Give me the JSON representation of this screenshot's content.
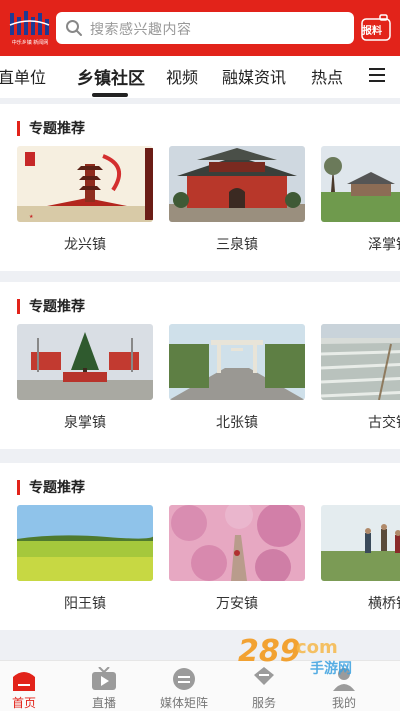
{
  "header": {
    "logo_text": "中乐乡镇 新闻网",
    "search_placeholder": "搜索感兴趣内容",
    "report_label": "报料",
    "brand_color": "#e2231a"
  },
  "tabs": [
    {
      "label": "县直单位"
    },
    {
      "label": "乡镇社区",
      "active": true
    },
    {
      "label": "视频"
    },
    {
      "label": "融媒资讯"
    },
    {
      "label": "热点"
    }
  ],
  "sections": [
    {
      "title": "专题推荐",
      "items": [
        {
          "label": "龙兴镇",
          "icon": "monument-image"
        },
        {
          "label": "三泉镇",
          "icon": "temple-image"
        },
        {
          "label": "泽掌镇",
          "icon": "village-image"
        }
      ]
    },
    {
      "title": "专题推荐",
      "items": [
        {
          "label": "泉掌镇",
          "icon": "square-image"
        },
        {
          "label": "北张镇",
          "icon": "gate-image"
        },
        {
          "label": "古交镇",
          "icon": "greenhouse-image"
        }
      ]
    },
    {
      "title": "专题推荐",
      "items": [
        {
          "label": "阳王镇",
          "icon": "field-image"
        },
        {
          "label": "万安镇",
          "icon": "blossom-image"
        },
        {
          "label": "横桥镇",
          "icon": "farmers-image"
        }
      ]
    }
  ],
  "bottom_nav": [
    {
      "label": "首页",
      "icon": "home-icon",
      "active": true
    },
    {
      "label": "直播",
      "icon": "tv-icon"
    },
    {
      "label": "媒体矩阵",
      "icon": "matrix-icon"
    },
    {
      "label": "服务",
      "icon": "service-icon"
    },
    {
      "label": "我的",
      "icon": "user-icon"
    }
  ],
  "watermark": {
    "brand": "289",
    "suffix": "com",
    "subtitle": "手游网"
  }
}
